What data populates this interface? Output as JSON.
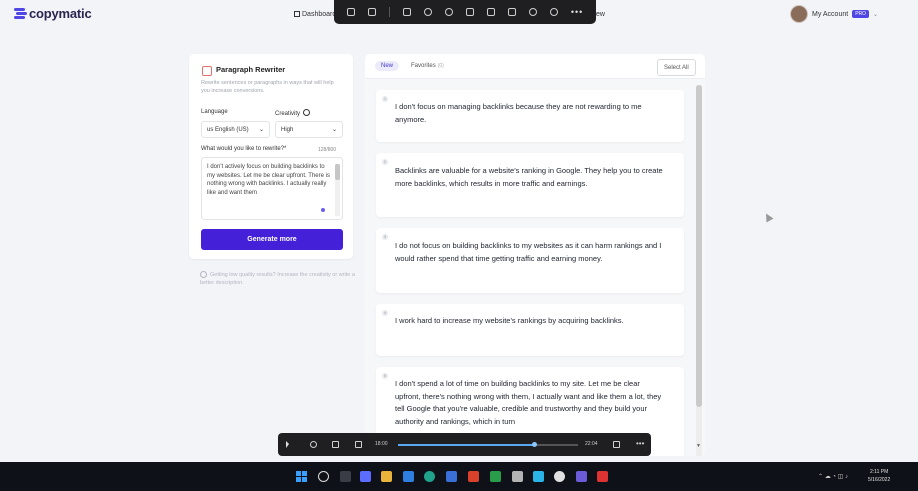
{
  "brand": {
    "name": "copymatic",
    "color": "#4f46e5"
  },
  "nav": {
    "dashboard": "Dashboard",
    "templates_partial": "ew"
  },
  "account": {
    "label": "My Account",
    "badge": "PRO"
  },
  "tool": {
    "title": "Paragraph Rewriter",
    "description": "Rewrite sentences or paragraphs in ways that will help you increase conversions."
  },
  "form": {
    "language_label": "Language",
    "language_value": "us English (US)",
    "creativity_label": "Creativity",
    "creativity_value": "High",
    "rewrite_label": "What would you like to rewrite?*",
    "limit": "128/800",
    "rewrite_value": "I don't actively focus on building backlinks to my websites. Let me be clear upfront. There is nothing wrong with backlinks. I actually really like and want them",
    "generate_button": "Generate more",
    "hint": "Getting low quality results? Increase the creativity or write a better description."
  },
  "results_panel": {
    "tabs": [
      {
        "label": "New"
      },
      {
        "label": "Favorites",
        "count": "(0)"
      }
    ],
    "select_all": "Select All",
    "results": [
      {
        "num": "1",
        "text": "I don't focus on managing backlinks because they are not rewarding to me anymore."
      },
      {
        "num": "2",
        "text": "Backlinks are valuable for a website's ranking in Google. They help you to create more backlinks, which results in more traffic and earnings."
      },
      {
        "num": "3",
        "text": "I do not focus on building backlinks to my websites as it can harm rankings and I would rather spend that time getting traffic and earning money."
      },
      {
        "num": "4",
        "text": "I work hard to increase my website's rankings by acquiring backlinks."
      },
      {
        "num": "5",
        "text": "I don't spend a lot of time on building backlinks to my site. Let me be clear upfront, there's nothing wrong with them, I actually want and like them a lot, they tell Google that you're valuable, credible and trustworthy and they build your authority and rankings, which in turn"
      }
    ]
  },
  "video_player": {
    "current_time": "18:00",
    "total_time": "22:04",
    "progress": 0.76
  },
  "taskbar": {
    "time": "2:11 PM",
    "date": "5/16/2022"
  }
}
